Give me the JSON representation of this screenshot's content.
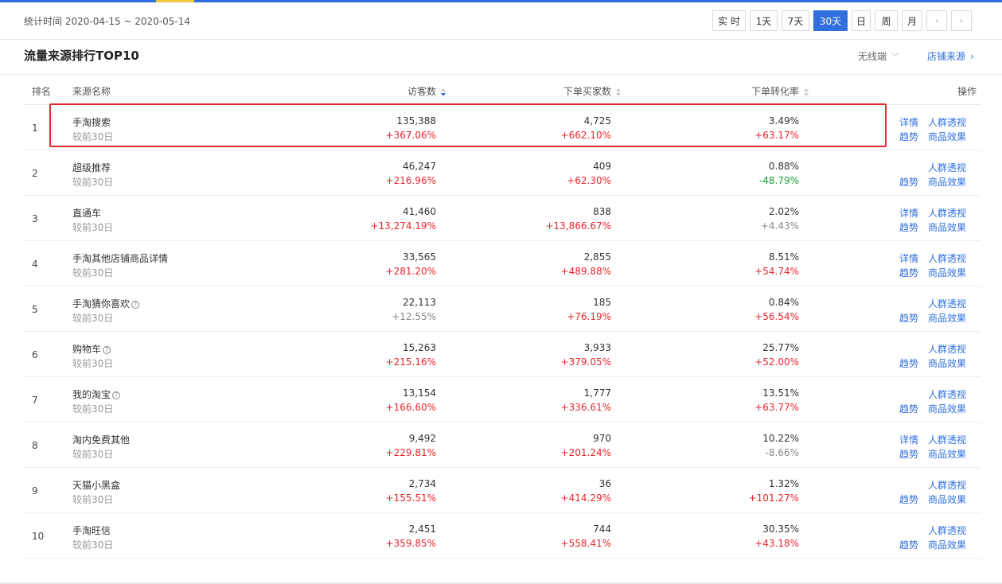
{
  "stat": {
    "label": "统计时间",
    "range": "2020-04-15 ~ 2020-05-14"
  },
  "periods": [
    {
      "label": "实 时",
      "active": false
    },
    {
      "label": "1天",
      "active": false
    },
    {
      "label": "7天",
      "active": false
    },
    {
      "label": "30天",
      "active": true
    },
    {
      "label": "日",
      "active": false
    },
    {
      "label": "周",
      "active": false
    },
    {
      "label": "月",
      "active": false
    },
    {
      "label": "‹",
      "active": false
    },
    {
      "label": "›",
      "active": false
    }
  ],
  "section": {
    "title": "流量来源排行TOP10",
    "device": "无线端",
    "shop_source": "店铺来源"
  },
  "columns": {
    "rank": "排名",
    "source": "来源名称",
    "visitors": "访客数",
    "buyers": "下单买家数",
    "rate": "下单转化率",
    "ops": "操作"
  },
  "compare_label": "较前30日",
  "ops_labels": {
    "detail": "详情",
    "crowd": "人群透视",
    "trend": "趋势",
    "goods": "商品效果"
  },
  "rows": [
    {
      "rank": "1",
      "name": "手淘搜索",
      "help": false,
      "visitors": "135,388",
      "visitors_chg": "+367.06%",
      "visitors_dir": "up",
      "buyers": "4,725",
      "buyers_chg": "+662.10%",
      "buyers_dir": "up",
      "rate": "3.49%",
      "rate_chg": "+63.17%",
      "rate_dir": "up",
      "has_detail": true
    },
    {
      "rank": "2",
      "name": "超级推荐",
      "help": false,
      "visitors": "46,247",
      "visitors_chg": "+216.96%",
      "visitors_dir": "up",
      "buyers": "409",
      "buyers_chg": "+62.30%",
      "buyers_dir": "up",
      "rate": "0.88%",
      "rate_chg": "-48.79%",
      "rate_dir": "down",
      "has_detail": false
    },
    {
      "rank": "3",
      "name": "直通车",
      "help": false,
      "visitors": "41,460",
      "visitors_chg": "+13,274.19%",
      "visitors_dir": "up",
      "buyers": "838",
      "buyers_chg": "+13,866.67%",
      "buyers_dir": "up",
      "rate": "2.02%",
      "rate_chg": "+4.43%",
      "rate_dir": "neutral",
      "has_detail": true
    },
    {
      "rank": "4",
      "name": "手淘其他店铺商品详情",
      "help": false,
      "visitors": "33,565",
      "visitors_chg": "+281.20%",
      "visitors_dir": "up",
      "buyers": "2,855",
      "buyers_chg": "+489.88%",
      "buyers_dir": "up",
      "rate": "8.51%",
      "rate_chg": "+54.74%",
      "rate_dir": "up",
      "has_detail": true
    },
    {
      "rank": "5",
      "name": "手淘猜你喜欢",
      "help": true,
      "visitors": "22,113",
      "visitors_chg": "+12.55%",
      "visitors_dir": "neutral",
      "buyers": "185",
      "buyers_chg": "+76.19%",
      "buyers_dir": "up",
      "rate": "0.84%",
      "rate_chg": "+56.54%",
      "rate_dir": "up",
      "has_detail": false
    },
    {
      "rank": "6",
      "name": "购物车",
      "help": true,
      "visitors": "15,263",
      "visitors_chg": "+215.16%",
      "visitors_dir": "up",
      "buyers": "3,933",
      "buyers_chg": "+379.05%",
      "buyers_dir": "up",
      "rate": "25.77%",
      "rate_chg": "+52.00%",
      "rate_dir": "up",
      "has_detail": false
    },
    {
      "rank": "7",
      "name": "我的淘宝",
      "help": true,
      "visitors": "13,154",
      "visitors_chg": "+166.60%",
      "visitors_dir": "up",
      "buyers": "1,777",
      "buyers_chg": "+336.61%",
      "buyers_dir": "up",
      "rate": "13.51%",
      "rate_chg": "+63.77%",
      "rate_dir": "up",
      "has_detail": false
    },
    {
      "rank": "8",
      "name": "淘内免费其他",
      "help": false,
      "visitors": "9,492",
      "visitors_chg": "+229.81%",
      "visitors_dir": "up",
      "buyers": "970",
      "buyers_chg": "+201.24%",
      "buyers_dir": "up",
      "rate": "10.22%",
      "rate_chg": "-8.66%",
      "rate_dir": "neutral",
      "has_detail": true
    },
    {
      "rank": "9",
      "name": "天猫小黑盒",
      "help": false,
      "visitors": "2,734",
      "visitors_chg": "+155.51%",
      "visitors_dir": "up",
      "buyers": "36",
      "buyers_chg": "+414.29%",
      "buyers_dir": "up",
      "rate": "1.32%",
      "rate_chg": "+101.27%",
      "rate_dir": "up",
      "has_detail": false
    },
    {
      "rank": "10",
      "name": "手淘旺信",
      "help": false,
      "visitors": "2,451",
      "visitors_chg": "+359.85%",
      "visitors_dir": "up",
      "buyers": "744",
      "buyers_chg": "+558.41%",
      "buyers_dir": "up",
      "rate": "30.35%",
      "rate_chg": "+43.18%",
      "rate_dir": "up",
      "has_detail": false
    }
  ],
  "colors": {
    "accent": "#2f6fde",
    "up": "#e8262d",
    "down": "#1a9a2c",
    "highlight": "#e8262d"
  }
}
